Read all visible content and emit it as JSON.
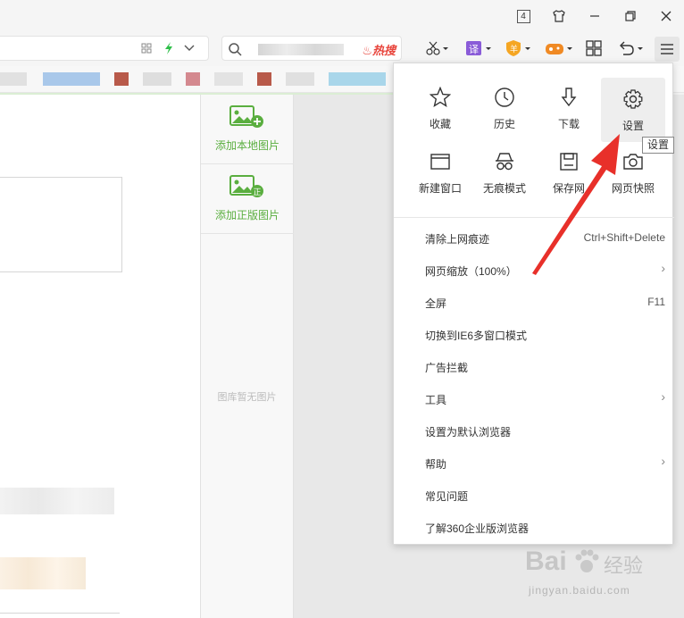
{
  "titlebar": {
    "tab_count": "4",
    "skin_icon": "tshirt-icon",
    "minimize_icon": "minimize-icon",
    "restore_icon": "restore-icon",
    "close_icon": "close-icon"
  },
  "search": {
    "hot_label": "热搜"
  },
  "side_panel": {
    "add_local_label": "添加本地图片",
    "add_licensed_label": "添加正版图片",
    "empty_label": "图库暂无图片"
  },
  "menu": {
    "grid": [
      {
        "label": "收藏",
        "icon": "star-icon"
      },
      {
        "label": "历史",
        "icon": "clock-icon"
      },
      {
        "label": "下载",
        "icon": "download-icon"
      },
      {
        "label": "设置",
        "icon": "gear-icon"
      },
      {
        "label": "新建窗口",
        "icon": "window-icon"
      },
      {
        "label": "无痕模式",
        "icon": "incognito-icon"
      },
      {
        "label": "保存网",
        "icon": "save-icon"
      },
      {
        "label": "网页快照",
        "icon": "camera-icon"
      }
    ],
    "items": [
      {
        "label": "清除上网痕迹",
        "shortcut": "Ctrl+Shift+Delete"
      },
      {
        "label": "网页缩放（100%）",
        "shortcut": ""
      },
      {
        "label": "全屏",
        "shortcut": "F11"
      },
      {
        "label": "切换到IE6多窗口模式",
        "shortcut": ""
      },
      {
        "label": "广告拦截",
        "shortcut": ""
      },
      {
        "label": "工具",
        "shortcut": ""
      },
      {
        "label": "设置为默认浏览器",
        "shortcut": ""
      },
      {
        "label": "帮助",
        "shortcut": ""
      },
      {
        "label": "常见问题",
        "shortcut": ""
      },
      {
        "label": "了解360企业版浏览器",
        "shortcut": ""
      }
    ],
    "tooltip": "设置"
  },
  "watermark": {
    "brand": "Bai",
    "brand_suffix": "经验",
    "url": "jingyan.baidu.com"
  },
  "colors": {
    "accent_green": "#5aae3f",
    "hot_red": "#e8453c",
    "arrow_red": "#e8302a"
  }
}
